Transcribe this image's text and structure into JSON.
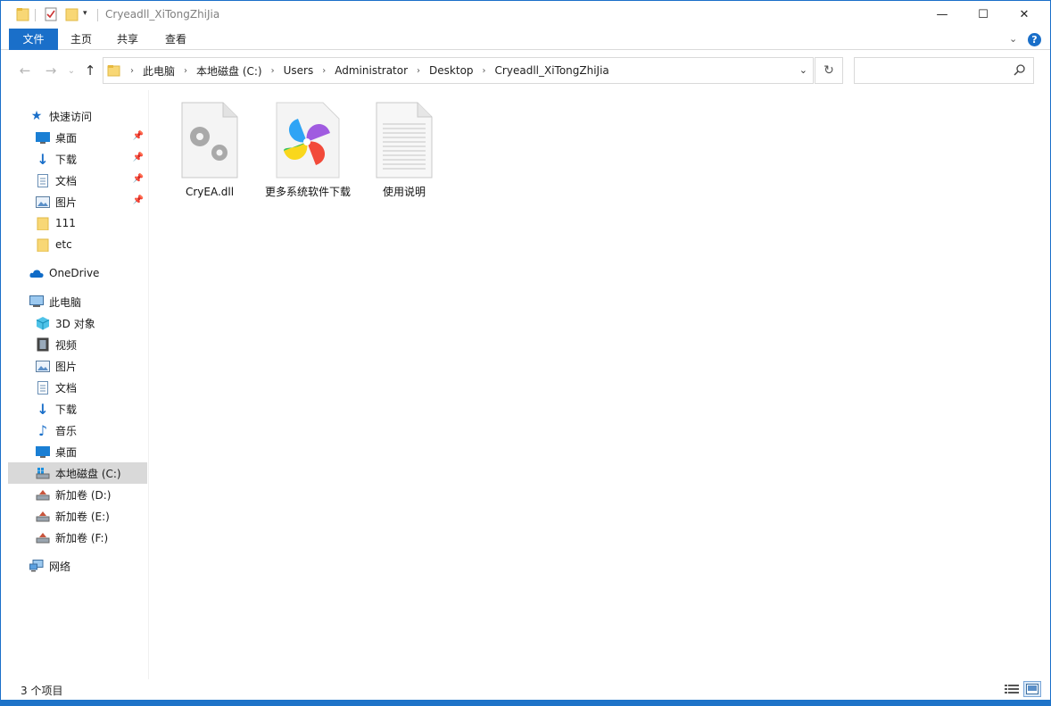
{
  "window": {
    "title": "Cryeadll_XiTongZhiJia",
    "controls": {
      "minimize": "—",
      "maximize": "☐",
      "close": "✕"
    }
  },
  "ribbon": {
    "tabs": [
      "文件",
      "主页",
      "共享",
      "查看"
    ]
  },
  "navigation": {
    "back": "←",
    "forward": "→",
    "up": "↑",
    "breadcrumbs": [
      "此电脑",
      "本地磁盘 (C:)",
      "Users",
      "Administrator",
      "Desktop",
      "Cryeadll_XiTongZhiJia"
    ],
    "search_placeholder": ""
  },
  "sidebar": {
    "quick_access": "快速访问",
    "quick_items": [
      "桌面",
      "下载",
      "文档",
      "图片",
      "111",
      "etc"
    ],
    "onedrive": "OneDrive",
    "this_pc": "此电脑",
    "pc_items": [
      "3D 对象",
      "视频",
      "图片",
      "文档",
      "下载",
      "音乐",
      "桌面",
      "本地磁盘 (C:)",
      "新加卷 (D:)",
      "新加卷 (E:)",
      "新加卷 (F:)"
    ],
    "network": "网络",
    "selected": "本地磁盘 (C:)"
  },
  "files": [
    {
      "name": "CryEA.dll",
      "icon": "dll-gear-icon"
    },
    {
      "name": "更多系统软件下载",
      "icon": "pinwheel-shortcut-icon"
    },
    {
      "name": "使用说明",
      "icon": "text-document-icon"
    }
  ],
  "status": {
    "item_count": "3 个项目"
  },
  "colors": {
    "accent": "#1a6fc9",
    "selected_bg": "#d9d9d9"
  }
}
